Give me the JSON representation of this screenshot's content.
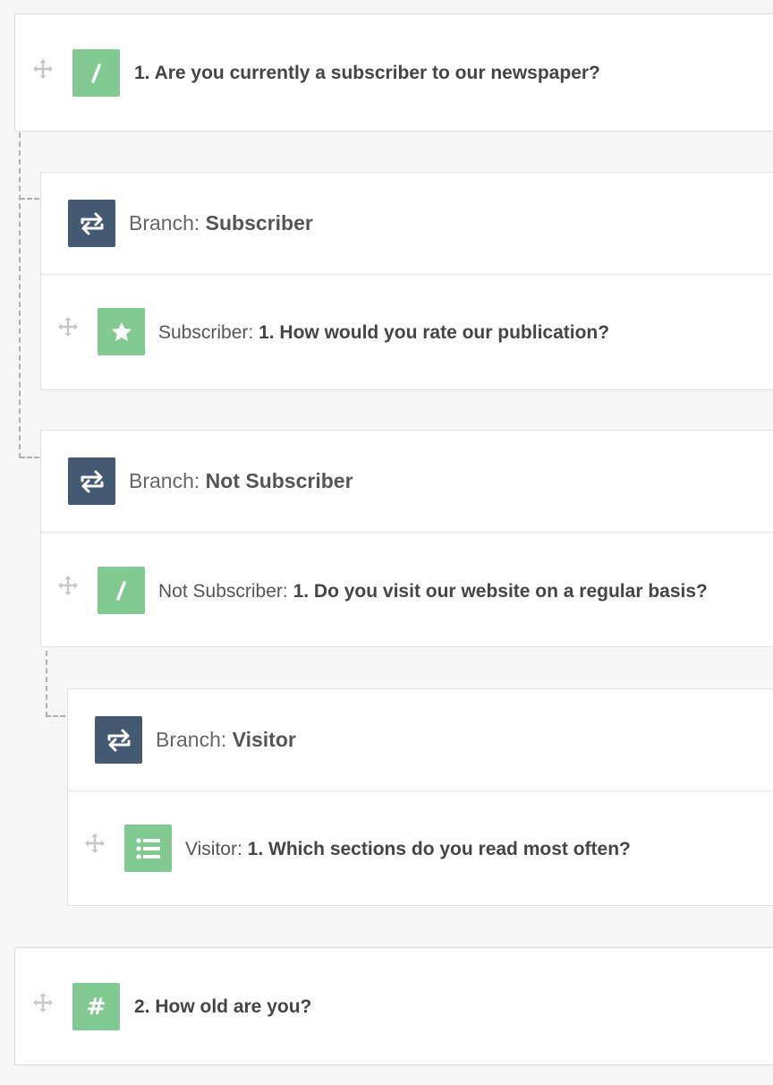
{
  "questions": [
    {
      "number_text": "1. Are you currently a subscriber to our newspaper?",
      "icon": "pencil-icon"
    },
    {
      "number_text": "2. How old are you?",
      "icon": "hash-icon",
      "symbol": "#"
    }
  ],
  "branches": [
    {
      "prefix": "Branch:",
      "name": "Subscriber",
      "child": {
        "prefix": "Subscriber:",
        "question": "1. How would you rate our publication?",
        "icon": "star-icon"
      }
    },
    {
      "prefix": "Branch:",
      "name": "Not Subscriber",
      "child": {
        "prefix": "Not Subscriber:",
        "question": "1. Do you visit our website on a regular basis?",
        "icon": "pencil-icon"
      }
    },
    {
      "prefix": "Branch:",
      "name": "Visitor",
      "child": {
        "prefix": "Visitor:",
        "question": "1. Which sections do you read most often?",
        "icon": "list-icon"
      }
    }
  ],
  "colors": {
    "question_tile": "#82c992",
    "branch_tile": "#435a72",
    "background": "#f6f6f6"
  }
}
